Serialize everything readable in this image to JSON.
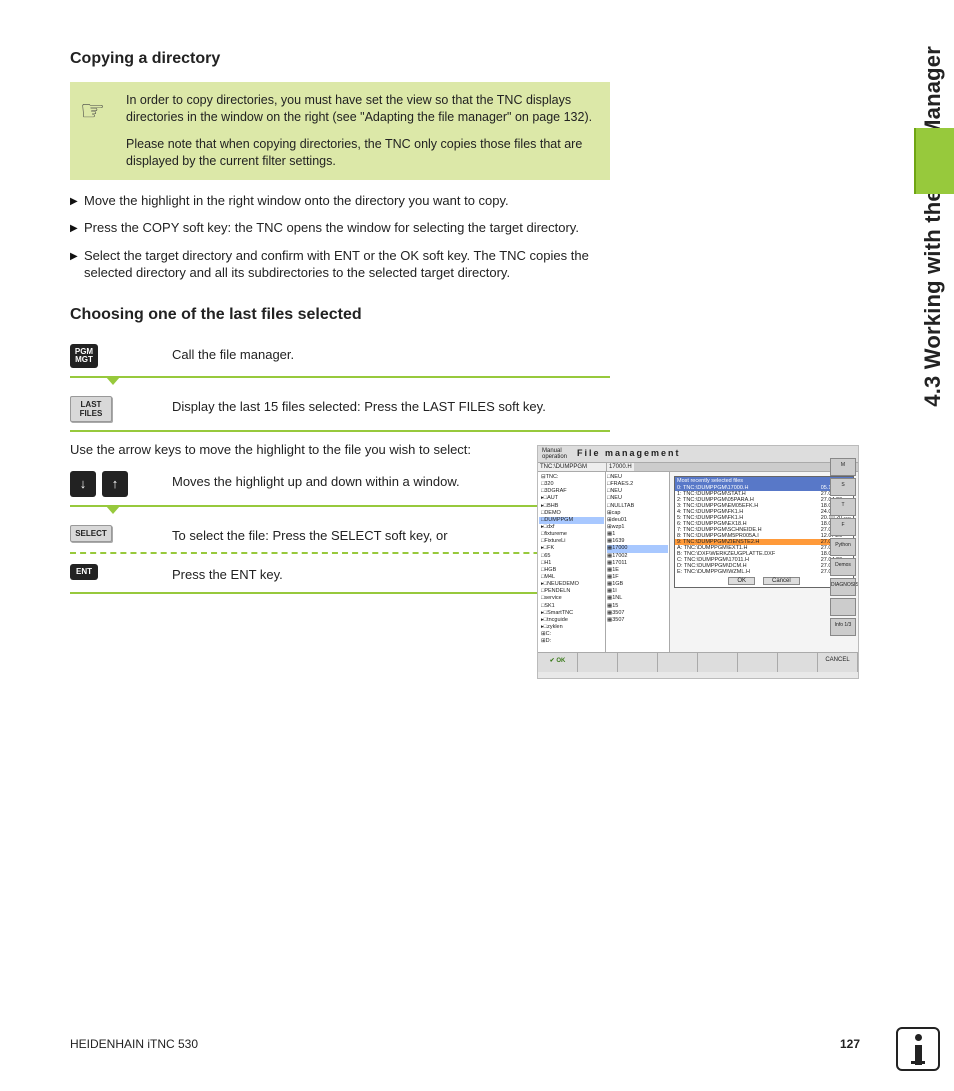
{
  "side_section": "4.3 Working with the File Manager",
  "h1": "Copying a directory",
  "note_p1": "In order to copy directories, you must have set the view so that the TNC displays directories in the window on the right (see \"Adapting the file manager\" on page 132).",
  "note_p2": "Please note that when copying directories, the TNC only copies those files that are displayed by the current filter settings.",
  "b1": "Move the highlight in the right window onto the directory you want to copy.",
  "b2": "Press the COPY soft key: the TNC opens the window for selecting the target directory.",
  "b3": "Select the target directory and confirm with ENT or the OK soft key. The TNC copies the selected directory and all its subdirectories to the selected target directory.",
  "h2": "Choosing one of the last files selected",
  "k_pgm": "PGM\nMGT",
  "s1": "Call the file manager.",
  "k_last": "LAST\nFILES",
  "s2": "Display the last 15 files selected: Press the LAST FILES soft key.",
  "s3": "Use the arrow keys to move the highlight to the file you wish to select:",
  "s4": "Moves the highlight up and down within a window.",
  "k_select": "SELECT",
  "s5": "To select the file: Press the SELECT soft key, or",
  "k_ent": "ENT",
  "s6": "Press the ENT key.",
  "shot_mode": "Manual\noperation",
  "shot_title": "File management",
  "shot_path": "TNC:\\DUMPPGM",
  "shot_file": "17000.H",
  "popup_title": "Most recently selected files",
  "popup_rows": [
    {
      "n": "0:",
      "p": "TNC:\\DUMPPGM\\17000.H",
      "d": "05.10.20"
    },
    {
      "n": "1:",
      "p": "TNC:\\DUMPPGM\\STAT.H",
      "d": "27.04.20"
    },
    {
      "n": "2:",
      "p": "TNC:\\DUMPPGM\\05PARA.H",
      "d": "27.04.20"
    },
    {
      "n": "3:",
      "p": "TNC:\\DUMPPGM\\EM05EFK.H",
      "d": "18.04.20"
    },
    {
      "n": "4:",
      "p": "TNC:\\DUMPPGM\\FK1.H",
      "d": "24.08.20"
    },
    {
      "n": "5:",
      "p": "TNC:\\DUMPPGM\\FK1.H",
      "d": "20.10.20"
    },
    {
      "n": "6:",
      "p": "TNC:\\DUMPPGM\\EX18.H",
      "d": "18.01.20"
    },
    {
      "n": "7:",
      "p": "TNC:\\DUMPPGM\\SCHNEIDE.H",
      "d": "27.04.20"
    },
    {
      "n": "8:",
      "p": "TNC:\\DUMPPGM\\M5PR005A.I",
      "d": "12.07.20"
    },
    {
      "n": "9:",
      "p": "TNC:\\DUMPPGM\\ZIENSTE2.H",
      "d": "27.07.20"
    },
    {
      "n": "A:",
      "p": "TNC:\\DUMPPGM\\EXT1.H",
      "d": "27.04.20"
    },
    {
      "n": "B:",
      "p": "TNC:\\DXF\\WERKZEUGPLATTE.DXF",
      "d": "18.04.20"
    },
    {
      "n": "C:",
      "p": "TNC:\\DUMPPGM\\17011.H",
      "d": "27.04.20"
    },
    {
      "n": "D:",
      "p": "TNC:\\DUMPPGM\\DCM.H",
      "d": "27.04.20"
    },
    {
      "n": "E:",
      "p": "TNC:\\DUMPPGM\\WZML.H",
      "d": "27.04.20"
    }
  ],
  "tree": [
    "⊟TNC:",
    "□320",
    "□3DGRAF",
    "▸□AUT",
    "▸□BHB",
    "□DEMO",
    "□DUMPPGM",
    "▸□dxf",
    "□fixtureme",
    "□FixtureLi",
    "▸□FK",
    "□65",
    "□H1",
    "□HGB",
    "□M4L",
    "▸□NEUEDEMO",
    "□PENDELN",
    "□service",
    "□SK1",
    "▸□SmartTNC",
    "▸□tncguide",
    "▸□zyklen",
    "⊞C:",
    "⊞D:"
  ],
  "list": [
    "□NEU",
    "□FRAES.2",
    "□NEU",
    "□NEU",
    "□NULLTAB",
    "⊞cap",
    "⊞deu01",
    "⊞wzp1",
    "▦1",
    "▦1639",
    "▦17000",
    "▦17002",
    "▦17011",
    "▦1E",
    "▦1F",
    "▦1GB",
    "▦1I",
    "▦1NL",
    "▦15",
    "▦3507",
    "▦3507"
  ],
  "btn_ok": "OK",
  "btn_cancel": "Cancel",
  "sb_ok": "OK",
  "sb_cancel": "CANCEL",
  "side_btns": [
    "M",
    "S",
    "T",
    "F",
    "Python",
    "Demos",
    "DIAGNOSIS",
    "",
    "Info 1/3"
  ],
  "footer_left": "HEIDENHAIN iTNC 530",
  "footer_right": "127"
}
